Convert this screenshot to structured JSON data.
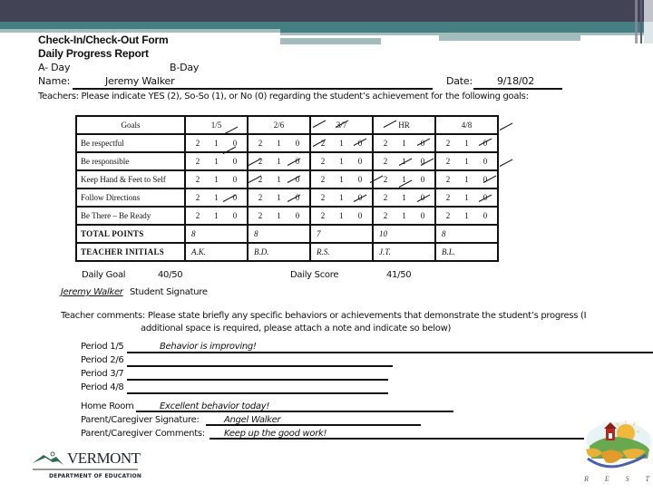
{
  "form": {
    "title": "Check-In/Check-Out Form",
    "subtitle": "Daily Progress Report",
    "a_day_label": "A- Day",
    "b_day_label": "B-Day",
    "name_label": "Name:",
    "name_value": "Jeremy Walker",
    "date_label": "Date:",
    "date_value": "9/18/02",
    "instructions": "Teachers:  Please indicate YES (2), So-So (1), or No (0) regarding the student’s achievement for the following goals:"
  },
  "table": {
    "goals_header": "Goals",
    "periods": [
      "1/5",
      "2/6",
      "3/7",
      "HR",
      "4/8"
    ],
    "scale": [
      "2",
      "1",
      "0"
    ],
    "rows": [
      {
        "goal": "Be respectful"
      },
      {
        "goal": "Be responsible"
      },
      {
        "goal": "Keep Hand & Feet to Self"
      },
      {
        "goal": "Follow Directions"
      },
      {
        "goal": "Be There – Be Ready"
      }
    ],
    "total_label": "TOTAL POINTS",
    "totals": [
      "8",
      "8",
      "7",
      "10",
      "8"
    ],
    "initials_label": "TEACHER INITIALS",
    "initials": [
      "A.K.",
      "B.D.",
      "R.S.",
      "J.T.",
      "B.L."
    ]
  },
  "summary": {
    "daily_goal_label": "Daily Goal",
    "daily_goal_value": "40/50",
    "daily_score_label": "Daily Score",
    "daily_score_value": "41/50",
    "student_signature_value": "Jeremy Walker",
    "student_signature_label": "Student Signature"
  },
  "comments": {
    "intro_line1": "Teacher comments:  Please state briefly any specific behaviors or achievements that demonstrate the student’s progress  (I",
    "intro_line2": "additional space is required, please attach a note and indicate so below)",
    "periods": [
      {
        "label": "Period 1/5",
        "value": "Behavior is improving!"
      },
      {
        "label": "Period 2/6",
        "value": ""
      },
      {
        "label": "Period 3/7",
        "value": ""
      },
      {
        "label": "Period 4/8",
        "value": ""
      }
    ],
    "home_room_label": "Home Room",
    "home_room_value": "Excellent behavior today!",
    "parent_signature_label": "Parent/Caregiver Signature:",
    "parent_signature_value": "Angel Walker",
    "parent_comments_label": "Parent/Caregiver Comments:",
    "parent_comments_value": "Keep up the good work!"
  },
  "logos": {
    "vermont_name": "VERMONT",
    "vermont_dept": "DEPARTMENT OF EDUCATION",
    "rest_letters": [
      "R",
      "E",
      "S",
      "T"
    ]
  }
}
